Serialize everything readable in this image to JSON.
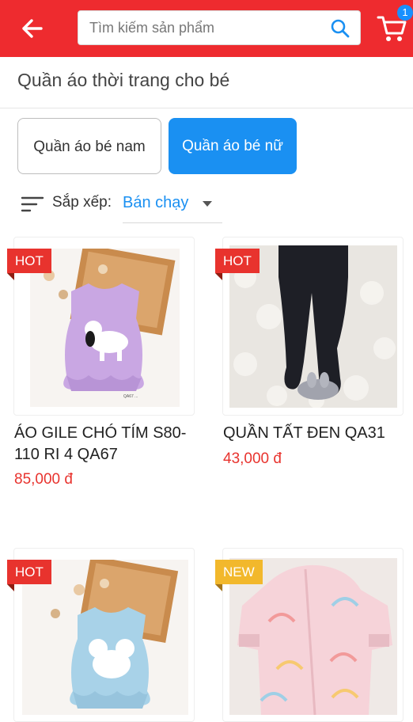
{
  "header": {
    "search_placeholder": "Tìm kiếm sản phẩm",
    "cart_count": "1",
    "color": "#ee2b2f"
  },
  "page": {
    "title": "Quần áo thời trang cho bé"
  },
  "categories": [
    {
      "label": "Quần áo bé nam",
      "active": false
    },
    {
      "label": "Quần áo bé nữ",
      "active": true
    }
  ],
  "sort": {
    "label": "Sắp xếp:",
    "value": "Bán chạy"
  },
  "products": [
    {
      "badge": "HOT",
      "name": "ÁO GILE CHÓ TÍM S80-110 RI 4 QA67",
      "price": "85,000 đ"
    },
    {
      "badge": "HOT",
      "name": "QUẦN TẤT ĐEN QA31",
      "price": "43,000 đ"
    },
    {
      "badge": "HOT",
      "name": "",
      "price": ""
    },
    {
      "badge": "NEW",
      "name": "",
      "price": ""
    }
  ],
  "colors": {
    "accent": "#1a90f2",
    "hot": "#e8332e",
    "new": "#f2b82c"
  },
  "icons": [
    "back-arrow-icon",
    "search-icon",
    "cart-icon",
    "sort-icon",
    "caret-down-icon"
  ]
}
